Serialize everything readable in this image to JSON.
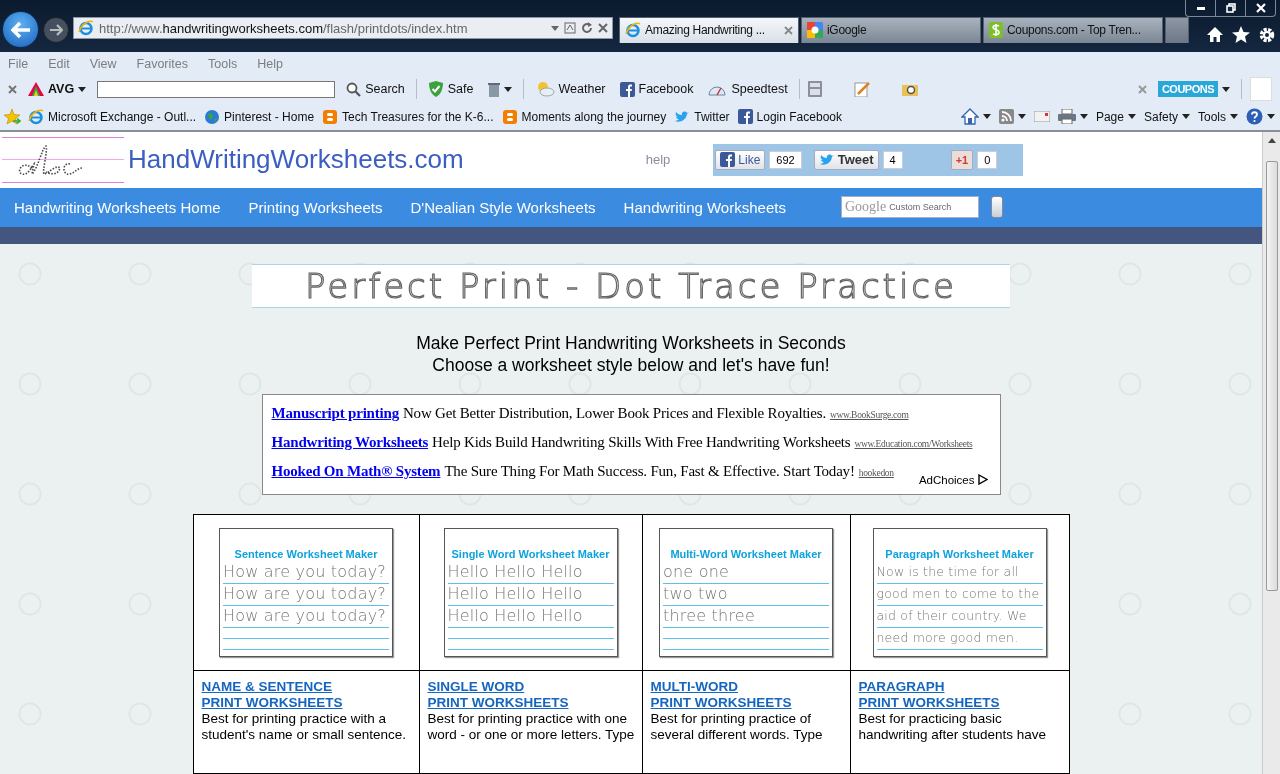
{
  "browser": {
    "address": {
      "prefix": "http://www.",
      "domain": "handwritingworksheets.com",
      "path": "/flash/printdots/index.htm"
    },
    "tabs": [
      {
        "label": "Amazing Handwriting ...",
        "selected": true
      },
      {
        "label": "iGoogle",
        "selected": false
      },
      {
        "label": "Coupons.com - Top Tren...",
        "selected": false
      }
    ],
    "menu": [
      "File",
      "Edit",
      "View",
      "Favorites",
      "Tools",
      "Help"
    ],
    "toolbar": {
      "brand": "AVG",
      "search_button": "Search",
      "items": [
        {
          "label": "Safe",
          "kind": "shield"
        },
        {
          "label": "Weather",
          "kind": "weather"
        },
        {
          "label": "Facebook",
          "kind": "facebook"
        },
        {
          "label": "Speedtest",
          "kind": "gauge"
        }
      ],
      "coupons": "COUPONS"
    },
    "favorites": [
      {
        "label": "Microsoft Exchange - Outl...",
        "kind": "ie"
      },
      {
        "label": "Pinterest - Home",
        "kind": "globe"
      },
      {
        "label": "Tech Treasures for the K-6...",
        "kind": "blogger"
      },
      {
        "label": "Moments along the journey",
        "kind": "blogger"
      },
      {
        "label": "Twitter",
        "kind": "twitter"
      },
      {
        "label": "Login  Facebook",
        "kind": "facebook"
      }
    ],
    "command_bar": [
      "Page",
      "Safety",
      "Tools"
    ]
  },
  "site": {
    "title": "HandWritingWorksheets.com",
    "help": "help",
    "social": [
      {
        "label": "Like",
        "count": "692",
        "kind": "facebook"
      },
      {
        "label": "Tweet",
        "count": "4",
        "kind": "twitter"
      },
      {
        "label": "+1",
        "count": "0",
        "kind": "google"
      }
    ],
    "nav": [
      "Handwriting Worksheets Home",
      "Printing Worksheets",
      "D'Nealian Style Worksheets",
      "Handwriting Worksheets"
    ],
    "search": {
      "logo": "Google",
      "placeholder": "Custom Search"
    },
    "banner": "Perfect Print - Dot Trace Practice",
    "headline": [
      "Make Perfect Print Handwriting Worksheets in Seconds",
      "Choose a worksheet style below and let's have fun!"
    ],
    "ads": [
      {
        "link": "Manuscript printing",
        "text": "Now Get Better Distribution, Lower Book Prices and Flexible Royalties.",
        "url": "www.BookSurge.com"
      },
      {
        "link": "Handwriting Worksheets",
        "text": "Help Kids Build Handwriting Skills With Free Handwriting Worksheets",
        "url": "www.Education.com/Worksheets"
      },
      {
        "link": "Hooked On Math® System",
        "text": "The Sure Thing For Math Success. Fun, Fast & Effective. Start Today!",
        "url": "hookedon"
      }
    ],
    "adchoices": "AdChoices",
    "cards": [
      {
        "thumb_title": "Sentence Worksheet Maker",
        "thumb_lines": [
          "How are you today?",
          "How are you today?",
          "How are you today?"
        ],
        "heading": [
          "NAME & SENTENCE",
          "PRINT WORKSHEETS"
        ],
        "description": [
          "Best for printing practice with a",
          "student's name or small sentence."
        ]
      },
      {
        "thumb_title": "Single Word Worksheet Maker",
        "thumb_lines": [
          "Hello Hello Hello",
          "Hello Hello Hello",
          "Hello Hello Hello"
        ],
        "heading": [
          "SINGLE WORD",
          "PRINT WORKSHEETS"
        ],
        "description": [
          "Best for printing practice with one",
          "word - or one or more letters. Type"
        ]
      },
      {
        "thumb_title": "Multi-Word Worksheet Maker",
        "thumb_lines": [
          "one  one",
          "two  two",
          "three  three"
        ],
        "heading": [
          "MULTI-WORD",
          "PRINT WORKSHEETS"
        ],
        "description": [
          "Best for printing practice of",
          "several different words. Type"
        ]
      },
      {
        "thumb_title": "Paragraph Worksheet Maker",
        "thumb_lines": [
          "Now is the time for all",
          "good men to come to the",
          "aid of their country.  We",
          "need more good men."
        ],
        "heading": [
          "PARAGRAPH",
          "PRINT WORKSHEETS"
        ],
        "description": [
          "Best for practicing basic",
          "handwriting after students have"
        ]
      }
    ]
  }
}
